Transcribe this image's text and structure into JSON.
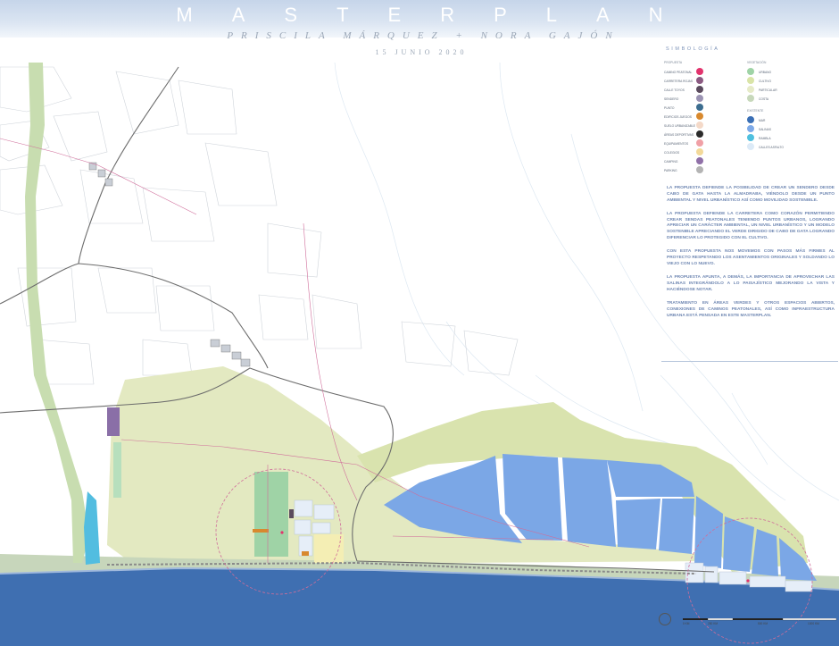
{
  "header": {
    "title": "MASTERPLAN",
    "authors": "PRISCILA MÁRQUEZ + NORA GAJÓN",
    "date": "15 JUNIO 2020"
  },
  "legend": {
    "title": "SIMBOLOGÍA",
    "col1_title": "PROPUESTA",
    "col1": [
      {
        "label": "CAMINO PEATONAL",
        "color": "#e2336d"
      },
      {
        "label": "CARRETERA ROJAS",
        "color": "#8b5a82"
      },
      {
        "label": "CALLE TOYOS",
        "color": "#5b4b5e"
      },
      {
        "label": "SENDERO",
        "color": "#9b93b3"
      },
      {
        "label": "PUNTO",
        "color": "#3c6d8f"
      },
      {
        "label": "EDIFICIOS JUEGOS",
        "color": "#d8892e"
      },
      {
        "label": "SUELO URBANIZABLE",
        "color": "#f4d9c8"
      },
      {
        "label": "ÁREAS DEPORTIVAS",
        "color": "#2b2b2b"
      },
      {
        "label": "EQUIPAMIENTOS",
        "color": "#f0a0a6"
      },
      {
        "label": "COLEGIOS",
        "color": "#f3d99a"
      },
      {
        "label": "CAMPING",
        "color": "#9070a8"
      },
      {
        "label": "PARKING",
        "color": "#b4b4b4"
      }
    ],
    "col2_title": "VEGETACIÓN",
    "col2": [
      {
        "label": "URBANO",
        "color": "#9fd3a6"
      },
      {
        "label": "CULTIVO",
        "color": "#d9e4a7"
      },
      {
        "label": "PARTICULAR",
        "color": "#e6ebc8"
      },
      {
        "label": "COSTA",
        "color": "#c7d8bb"
      }
    ],
    "col3_title": "EXISTENTE",
    "col3": [
      {
        "label": "MAR",
        "color": "#3a6fb5"
      },
      {
        "label": "SALINAS",
        "color": "#7eaae8"
      },
      {
        "label": "RAMBLA",
        "color": "#4fc0df"
      },
      {
        "label": "CALLES ASFALTO",
        "color": "#dceaf7"
      }
    ]
  },
  "text_panel": [
    "La propuesta defiende la posibilidad de crear un sendero desde Cabo de Gata hasta La Almadraba, viéndolo desde un punto ambiental y nivel urbanístico así como movilidad sostenible.",
    "La propuesta defiende la carretera como corazón permitiendo crear sendas peatonales teniendo puntos urbanos, logrando apreciar un carácter ambiental, un nivel urbanístico y un modelo sostenible apreciando el verde dirigido de Cabo de Gata logrando diferenciar lo protegido con el cultivo.",
    "Con esta propuesta nos movemos con pasos más firmes al proyecto respetando los asentamientos originales y soldando lo viejo con lo nuevo.",
    "La propuesta apunta, a demás, la importancia de aprovechar las salinas integrándolo a lo paisajístico mejorando la vista y haciéndose notar.",
    "Tratamiento en áreas verdes y otros espacios abiertos, conexiones de caminos peatonales, así como infraestructura urbana está pensada en este masterplan."
  ],
  "scale": {
    "labels": [
      "0 KM",
      "250 KM",
      "500 KM",
      "1000 KM"
    ]
  },
  "colors": {
    "sea": "#3f6fb1",
    "salinas": "#7ba7e6",
    "rambla": "#52bde0",
    "cultivo": "#dfe6b8",
    "urbano": "#9fd3a6",
    "coast": "#c9d6bd",
    "yellow_zone": "#f4eeb4",
    "roads": "#6e6e6e",
    "paths": "#d06d9a"
  }
}
